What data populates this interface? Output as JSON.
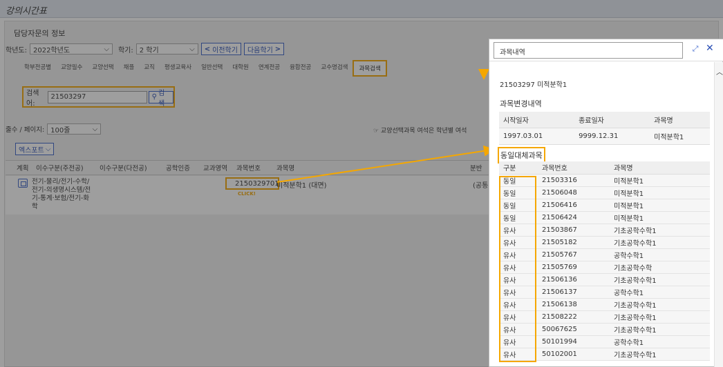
{
  "window": {
    "title": "강의시간표"
  },
  "main": {
    "section_title": "담당자문의 정보",
    "year_label": "학년도:",
    "year_value": "2022학년도",
    "semester_label": "학기:",
    "semester_value": "2 학기",
    "prev_label": "이전학기",
    "next_label": "다음학기",
    "tabs": [
      "학부전공별",
      "교양필수",
      "교양선택",
      "채플",
      "교직",
      "평생교육사",
      "일반선택",
      "대학원",
      "연계전공",
      "융합전공",
      "교수명검색",
      "과목검색"
    ],
    "search_label": "검색어:",
    "search_value": "21503297",
    "search_button": "검색",
    "pp_label": "줄수 / 페이지:",
    "pp_value": "100줄",
    "notice": "☞ 교양선택과목 여석은 학년별 여석",
    "export_label": "엑스포트",
    "table_headers": [
      "계획",
      "이수구분(주전공)",
      "이수구분(다전공)",
      "공학인증",
      "교과영역",
      "과목번호",
      "과목명",
      "분반"
    ],
    "row": {
      "major": "전기-물리/전기-수학/전기-의생명시스템/전기-통계·보험/전기-화학",
      "code": "2150329701",
      "name": "미적분학1 (대면)",
      "etc": "(공통",
      "click": "CLICK!"
    }
  },
  "popup": {
    "title": "과목내역",
    "course_id": "21503297  미적분학1",
    "change_title": "과목변경내역",
    "change_headers": [
      "시작일자",
      "종료일자",
      "과목명"
    ],
    "change_row": [
      "1997.03.01",
      "9999.12.31",
      "미적분학1"
    ],
    "sub_title": "동일대체과목",
    "sub_headers": [
      "구분",
      "과목번호",
      "과목명"
    ],
    "sub_rows": [
      [
        "동일",
        "21503316",
        "미적분학1"
      ],
      [
        "동일",
        "21506048",
        "미적분학1"
      ],
      [
        "동일",
        "21506416",
        "미적분학1"
      ],
      [
        "동일",
        "21506424",
        "미적분학1"
      ],
      [
        "유사",
        "21503867",
        "기초공학수학1"
      ],
      [
        "유사",
        "21505182",
        "기초공학수학1"
      ],
      [
        "유사",
        "21505767",
        "공학수학1"
      ],
      [
        "유사",
        "21505769",
        "기초공학수학"
      ],
      [
        "유사",
        "21506136",
        "기초공학수학1"
      ],
      [
        "유사",
        "21506137",
        "공학수학1"
      ],
      [
        "유사",
        "21506138",
        "기초공학수학1"
      ],
      [
        "유사",
        "21508222",
        "기초공학수학1"
      ],
      [
        "유사",
        "50067625",
        "기초공학수학1"
      ],
      [
        "유사",
        "50101994",
        "공학수학1"
      ],
      [
        "유사",
        "50102001",
        "기초공학수학1"
      ]
    ]
  },
  "colors": {
    "highlight": "#f5a700",
    "accent": "#2a4fb5"
  }
}
